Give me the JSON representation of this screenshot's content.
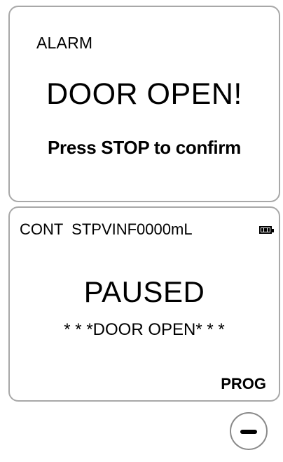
{
  "alarm_screen": {
    "label": "ALARM",
    "title": "DOOR OPEN!",
    "instruction": "Press STOP to confirm"
  },
  "status_screen": {
    "status_line": "CONT  STPVINF0000mL",
    "state": "PAUSED",
    "detail": "* * *DOOR OPEN* * *",
    "prog_label": "PROG",
    "battery_icon": "battery-full-icon"
  },
  "controls": {
    "minus_icon": "minus-icon"
  }
}
